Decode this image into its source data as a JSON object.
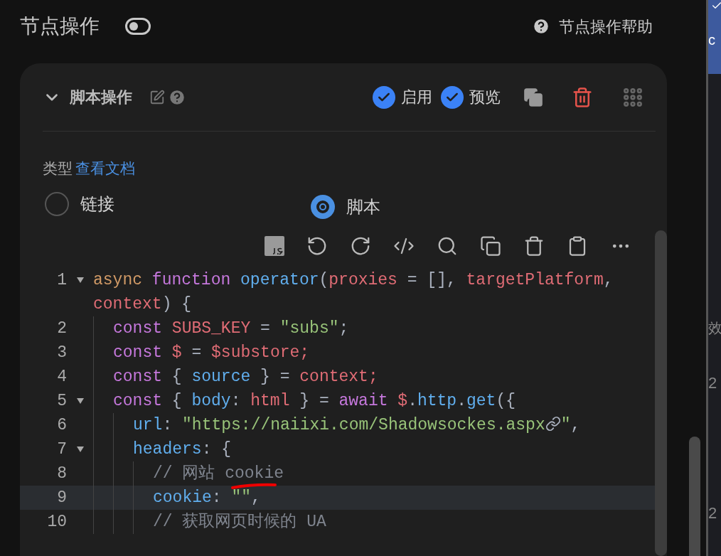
{
  "header": {
    "title": "节点操作",
    "toggle_on": false,
    "help": "节点操作帮助"
  },
  "card": {
    "title": "脚本操作",
    "expanded": true,
    "enable": {
      "label": "启用",
      "checked": true
    },
    "preview": {
      "label": "预览",
      "checked": true
    },
    "type_label": "类型",
    "doc_link": "查看文档",
    "options": [
      {
        "label": "链接",
        "selected": false
      },
      {
        "label": "脚本",
        "selected": true
      }
    ],
    "code": [
      {
        "number": "1",
        "foldable": true,
        "highlighted": false,
        "tokens": [
          {
            "kind": "storage",
            "text": "async "
          },
          {
            "kind": "keyword",
            "text": "function "
          },
          {
            "kind": "fn",
            "text": "operator"
          },
          {
            "kind": "punct",
            "text": "("
          },
          {
            "kind": "var",
            "text": "proxies"
          },
          {
            "kind": "punct",
            "text": " = [], "
          },
          {
            "kind": "var",
            "text": "targetPlatform"
          },
          {
            "kind": "punct",
            "text": ", "
          },
          {
            "kind": "var",
            "text": "context"
          },
          {
            "kind": "punct",
            "text": ") {"
          }
        ],
        "children": [
          {
            "number": "2",
            "foldable": false,
            "highlighted": false,
            "tokens": [
              {
                "kind": "keyword",
                "text": "const "
              },
              {
                "kind": "var",
                "text": "SUBS_KEY"
              },
              {
                "kind": "punct",
                "text": " = "
              },
              {
                "kind": "string",
                "text": "\"subs\""
              },
              {
                "kind": "punct",
                "text": ";"
              }
            ]
          },
          {
            "number": "3",
            "foldable": false,
            "highlighted": false,
            "tokens": [
              {
                "kind": "keyword",
                "text": "const "
              },
              {
                "kind": "var",
                "text": "$"
              },
              {
                "kind": "punct",
                "text": " = "
              },
              {
                "kind": "var",
                "text": "$substore;"
              }
            ]
          },
          {
            "number": "4",
            "foldable": false,
            "highlighted": false,
            "tokens": [
              {
                "kind": "keyword",
                "text": "const "
              },
              {
                "kind": "punct",
                "text": "{ "
              },
              {
                "kind": "prop",
                "text": "source"
              },
              {
                "kind": "punct",
                "text": " } = "
              },
              {
                "kind": "var",
                "text": "context;"
              }
            ]
          },
          {
            "number": "5",
            "foldable": true,
            "highlighted": false,
            "tokens": [
              {
                "kind": "keyword",
                "text": "const "
              },
              {
                "kind": "punct",
                "text": "{ "
              },
              {
                "kind": "prop",
                "text": "body"
              },
              {
                "kind": "punct",
                "text": ": "
              },
              {
                "kind": "var",
                "text": "html"
              },
              {
                "kind": "punct",
                "text": " } = "
              },
              {
                "kind": "keyword",
                "text": "await "
              },
              {
                "kind": "var",
                "text": "$"
              },
              {
                "kind": "punct",
                "text": "."
              },
              {
                "kind": "prop",
                "text": "http"
              },
              {
                "kind": "punct",
                "text": "."
              },
              {
                "kind": "fn",
                "text": "get"
              },
              {
                "kind": "punct",
                "text": "({"
              }
            ],
            "children": [
              {
                "number": "6",
                "foldable": false,
                "highlighted": false,
                "tokens": [
                  {
                    "kind": "prop",
                    "text": "url"
                  },
                  {
                    "kind": "punct",
                    "text": ": "
                  },
                  {
                    "kind": "string",
                    "text": "\"https://naiixi.com/Shadowsockes.aspx"
                  },
                  {
                    "kind": "link_icon"
                  },
                  {
                    "kind": "string",
                    "text": "\""
                  },
                  {
                    "kind": "punct",
                    "text": ","
                  }
                ]
              },
              {
                "number": "7",
                "foldable": true,
                "highlighted": false,
                "tokens": [
                  {
                    "kind": "prop",
                    "text": "headers"
                  },
                  {
                    "kind": "punct",
                    "text": ": {"
                  }
                ],
                "children": [
                  {
                    "number": "8",
                    "foldable": false,
                    "highlighted": false,
                    "tokens": [
                      {
                        "kind": "comment",
                        "text": "// 网站 cookie"
                      }
                    ]
                  },
                  {
                    "number": "9",
                    "foldable": false,
                    "highlighted": true,
                    "tokens": [
                      {
                        "kind": "prop",
                        "text": "cookie"
                      },
                      {
                        "kind": "punct",
                        "text": ": "
                      },
                      {
                        "kind": "string",
                        "text": "\"\""
                      },
                      {
                        "kind": "punct",
                        "text": ","
                      }
                    ]
                  },
                  {
                    "number": "10",
                    "foldable": false,
                    "highlighted": false,
                    "tokens": [
                      {
                        "kind": "comment",
                        "text": "// 获取网页时候的 UA"
                      }
                    ]
                  }
                ]
              }
            ]
          }
        ]
      }
    ]
  },
  "side_strip": {
    "top": "c",
    "texts": [
      "效",
      "2",
      "2"
    ]
  }
}
